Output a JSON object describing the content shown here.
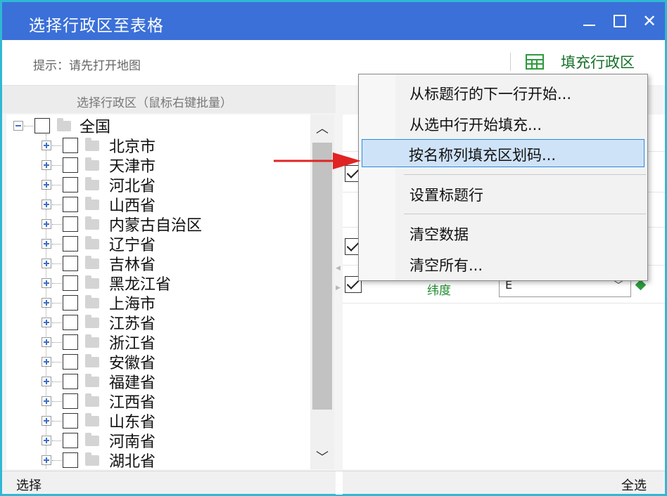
{
  "window": {
    "title": "选择行政区至表格"
  },
  "toolbar": {
    "hint": "提示：请先打开地图",
    "fill_button_label": "填充行政区"
  },
  "left_panel": {
    "header": "选择行政区（鼠标右键批量）",
    "tree": {
      "root": "全国",
      "items": [
        "北京市",
        "天津市",
        "河北省",
        "山西省",
        "内蒙古自治区",
        "辽宁省",
        "吉林省",
        "黑龙江省",
        "上海市",
        "江苏省",
        "浙江省",
        "安徽省",
        "福建省",
        "江西省",
        "山东省",
        "河南省",
        "湖北省"
      ]
    }
  },
  "right_panel": {
    "latitude_label": "纬度",
    "latitude_field_value": "E"
  },
  "context_menu": {
    "items": [
      {
        "label": "从标题行的下一行开始..."
      },
      {
        "label": "从选中行开始填充..."
      },
      {
        "label": "按名称列填充区划码..."
      },
      {
        "label": "设置标题行"
      },
      {
        "label": "清空数据"
      },
      {
        "label": "清空所有..."
      }
    ],
    "highlighted_index": 2
  },
  "statusbar": {
    "left": "选择",
    "right": "全选"
  },
  "colors": {
    "titlebar": "#3b70d8",
    "window_border": "#2fb8d4",
    "menu_highlight": "#cfe3f8",
    "menu_highlight_border": "#2a8be0",
    "accent_green": "#18702a",
    "arrow_red": "#e02424"
  },
  "icons": {
    "minimize": "minimize-icon",
    "maximize": "maximize-icon",
    "close": "close-icon",
    "table": "table-grid-icon",
    "folder": "folder-icon",
    "expand": "plus-expander-icon",
    "collapse": "minus-collapser-icon",
    "check": "checkmark-icon",
    "pointer": "red-arrow-icon"
  }
}
